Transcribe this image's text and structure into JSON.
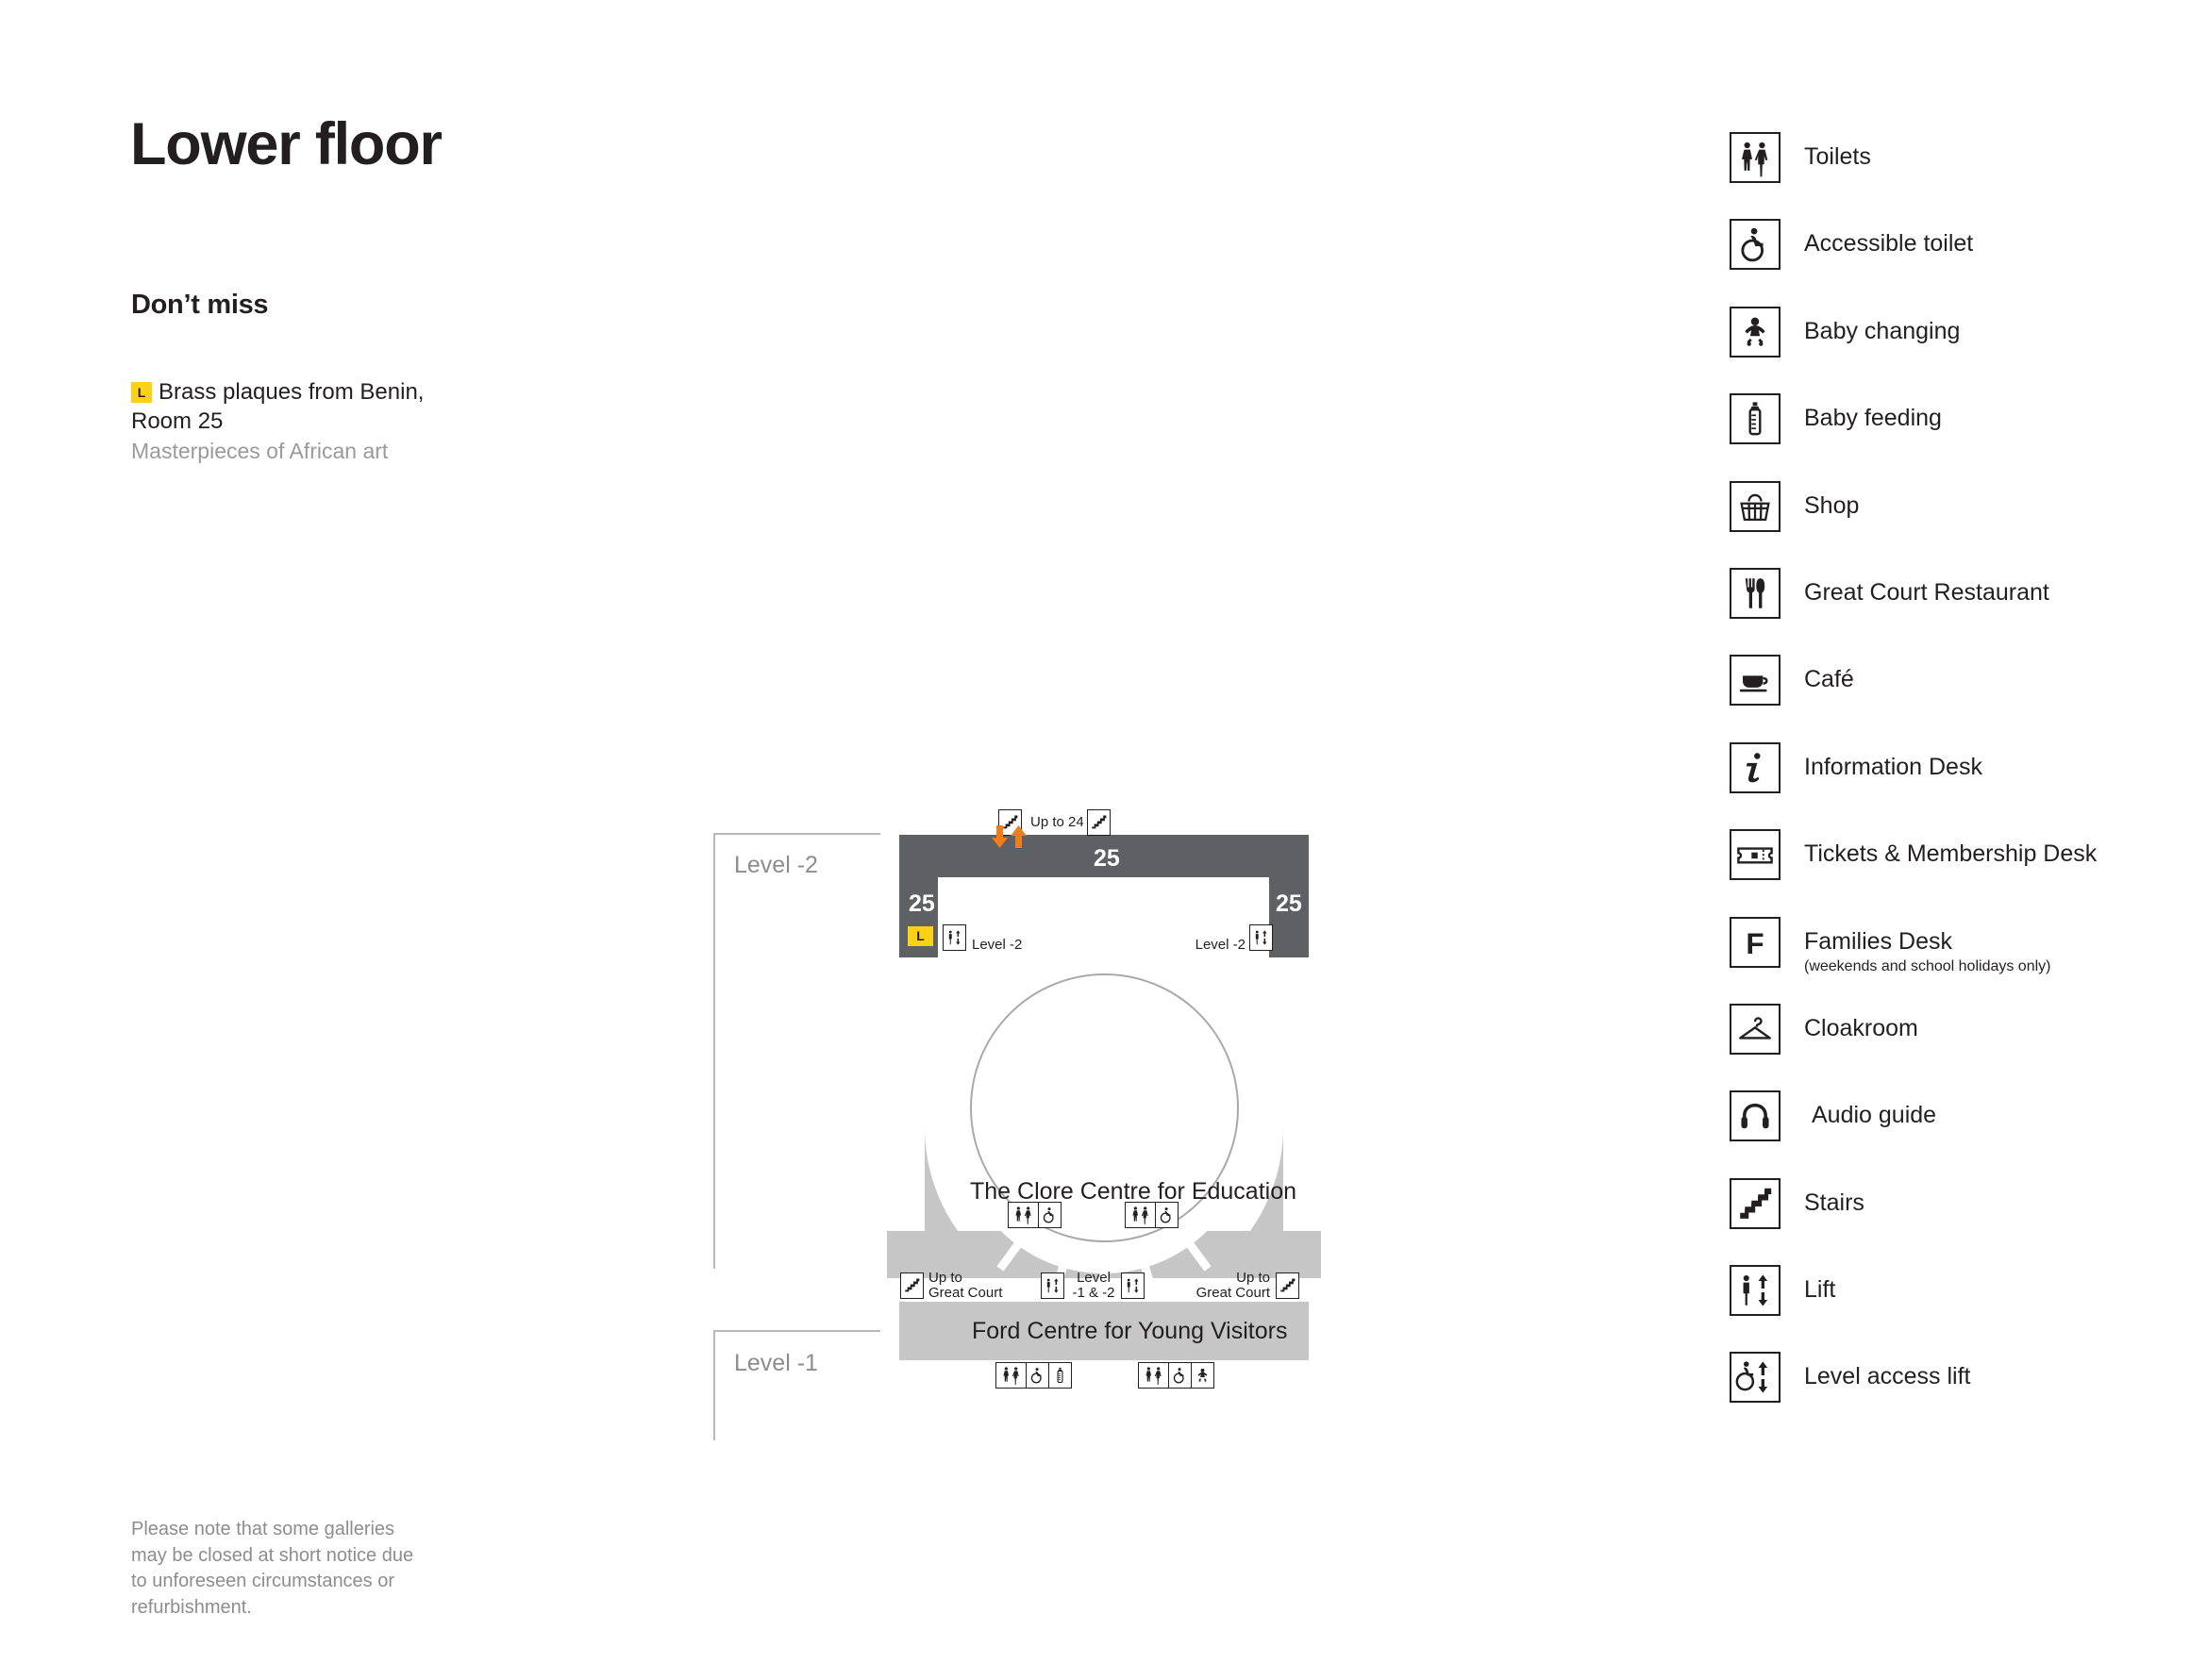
{
  "header": {
    "title": "Lower floor",
    "dont_miss_heading": "Don’t miss"
  },
  "dont_miss": {
    "badge": "L",
    "line1": "Brass plaques from Benin,",
    "line2": "Room 25",
    "subtitle": "Masterpieces of African art"
  },
  "footnote": "Please note that some galleries may be closed at short notice due to unforeseen circumstances or refurbishment.",
  "legend": {
    "items": [
      {
        "icon": "toilets-icon",
        "label": "Toilets",
        "sub": ""
      },
      {
        "icon": "accessible-toilet-icon",
        "label": "Accessible toilet",
        "sub": ""
      },
      {
        "icon": "baby-changing-icon",
        "label": "Baby changing",
        "sub": ""
      },
      {
        "icon": "baby-feeding-icon",
        "label": "Baby feeding",
        "sub": ""
      },
      {
        "icon": "shop-icon",
        "label": "Shop",
        "sub": ""
      },
      {
        "icon": "restaurant-icon",
        "label": "Great Court Restaurant",
        "sub": ""
      },
      {
        "icon": "cafe-icon",
        "label": "Café",
        "sub": ""
      },
      {
        "icon": "information-icon",
        "label": "Information Desk",
        "sub": ""
      },
      {
        "icon": "ticket-icon",
        "label": "Tickets & Membership Desk",
        "sub": ""
      },
      {
        "icon": "families-desk-icon",
        "label": "Families Desk",
        "sub": "(weekends and school holidays only)"
      },
      {
        "icon": "cloakroom-icon",
        "label": "Cloakroom",
        "sub": ""
      },
      {
        "icon": "audio-guide-icon",
        "label": "Audio guide",
        "sub": ""
      },
      {
        "icon": "stairs-icon",
        "label": "Stairs",
        "sub": ""
      },
      {
        "icon": "lift-icon",
        "label": "Lift",
        "sub": ""
      },
      {
        "icon": "level-access-lift-icon",
        "label": "Level access lift",
        "sub": ""
      }
    ]
  },
  "map": {
    "levels": [
      {
        "label": "Level -2"
      },
      {
        "label": "Level -1"
      }
    ],
    "gallery": {
      "room_top": "25",
      "room_left": "25",
      "room_right": "25",
      "badge": "L"
    },
    "stairs_top_label": "Up to 24",
    "lift_left_label": "Level -2",
    "lift_right_label": "Level -2",
    "clore": {
      "title": "The Clore Centre for Education"
    },
    "stairs_left_label": "Up to\nGreat Court",
    "stairs_left_line1": "Up to",
    "stairs_left_line2": "Great Court",
    "stairs_right_line1": "Up to",
    "stairs_right_line2": "Great Court",
    "lift_centre_line1": "Level",
    "lift_centre_line2": "-1 & -2",
    "ford": {
      "title": "Ford Centre for Young Visitors"
    }
  },
  "colors": {
    "gallery_dark": "#5e6064",
    "clore_gray": "#c6c6c6",
    "highlight_yellow": "#fcd116",
    "arrow_orange": "#f07d1a",
    "muted_text": "#8d8d8d"
  }
}
